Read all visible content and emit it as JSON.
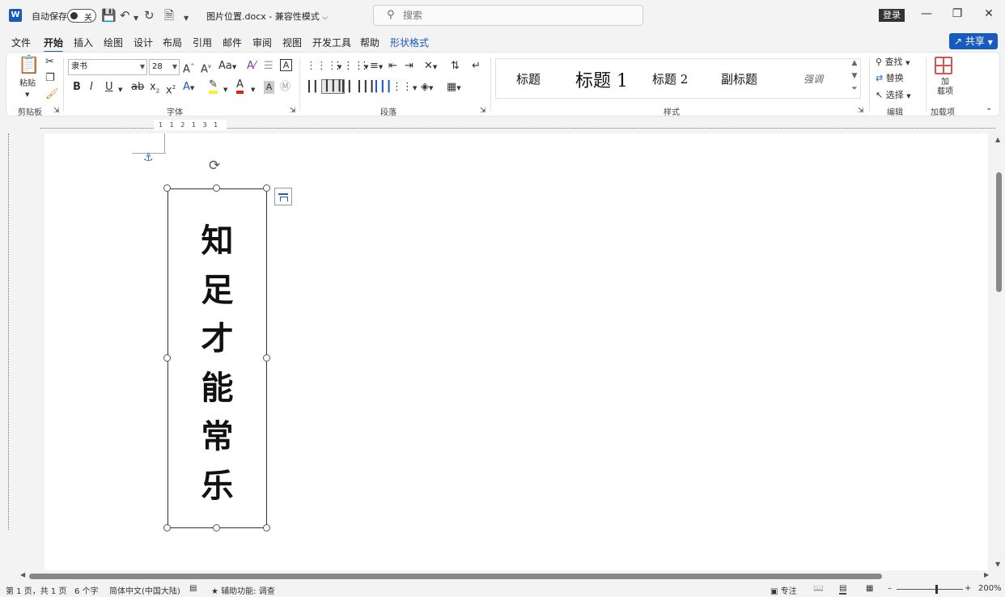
{
  "titlebar": {
    "app_icon": "W",
    "autosave_label": "自动保存",
    "autosave_state": "关",
    "filename": "图片位置.docx",
    "separator": "-",
    "mode": "兼容性模式",
    "search_placeholder": "搜索",
    "login": "登录"
  },
  "menu": {
    "tabs": [
      "文件",
      "开始",
      "插入",
      "绘图",
      "设计",
      "布局",
      "引用",
      "邮件",
      "审阅",
      "视图",
      "开发工具",
      "帮助",
      "形状格式"
    ],
    "active": "开始",
    "share": "共享"
  },
  "ribbon": {
    "clipboard": {
      "paste": "粘贴",
      "label": "剪贴板"
    },
    "font": {
      "name": "隶书",
      "size": "28",
      "label": "字体",
      "grow": "A",
      "shrink": "A",
      "case": "Aa"
    },
    "paragraph": {
      "label": "段落"
    },
    "styles": {
      "items": [
        "标题",
        "标题 1",
        "标题 2",
        "副标题",
        "强调"
      ],
      "label": "样式"
    },
    "editing": {
      "find": "查找",
      "replace": "替换",
      "select": "选择",
      "label": "编辑"
    },
    "addins": {
      "button": "加\n载项",
      "label": "加载项"
    }
  },
  "document": {
    "vertical_text": [
      "知",
      "足",
      "才",
      "能",
      "常",
      "乐"
    ]
  },
  "statusbar": {
    "page": "第 1 页，共 1 页",
    "words": "6 个字",
    "language": "简体中文(中国大陆)",
    "accessibility": "辅助功能: 调查",
    "focus": "专注",
    "zoom": "200%"
  },
  "colors": {
    "accent": "#185abd",
    "highlight": "#ffeb3b",
    "font_color": "#e02020",
    "addin": "#d9534f"
  }
}
